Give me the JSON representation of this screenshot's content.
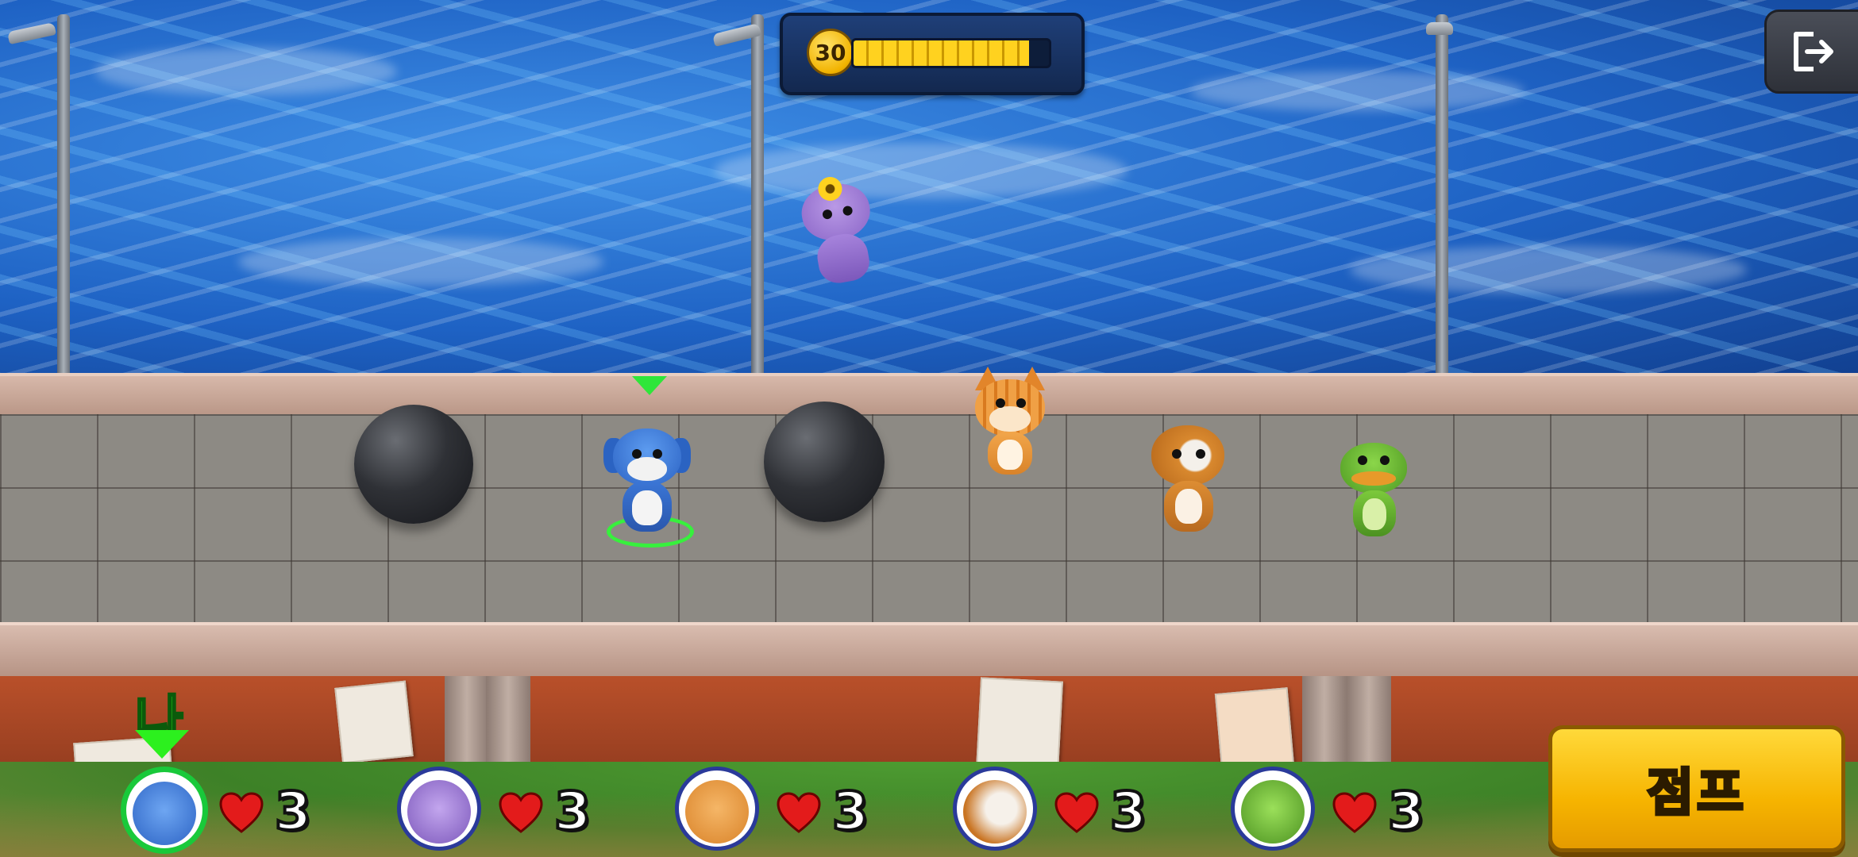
{
  "hud": {
    "timer_value": "30",
    "timer_progress": 0.9
  },
  "player_label": "나",
  "players": [
    {
      "id": "me",
      "character": "blue-dog",
      "lives": "3"
    },
    {
      "id": "p2",
      "character": "purple-hippo",
      "lives": "3"
    },
    {
      "id": "p3",
      "character": "orange-cat",
      "lives": "3"
    },
    {
      "id": "p4",
      "character": "brown-bulldog",
      "lives": "3"
    },
    {
      "id": "p5",
      "character": "green-frog",
      "lives": "3"
    }
  ],
  "jump_button": {
    "label": "점프"
  },
  "icons": {
    "exit": "exit-icon",
    "heart": "heart-icon",
    "coin": "timer-coin-icon"
  },
  "colors": {
    "heart": "#e31b1b",
    "me_highlight": "#2cf01e",
    "jump_button": "#f6b400",
    "timer_fill": "#ffd21f"
  }
}
